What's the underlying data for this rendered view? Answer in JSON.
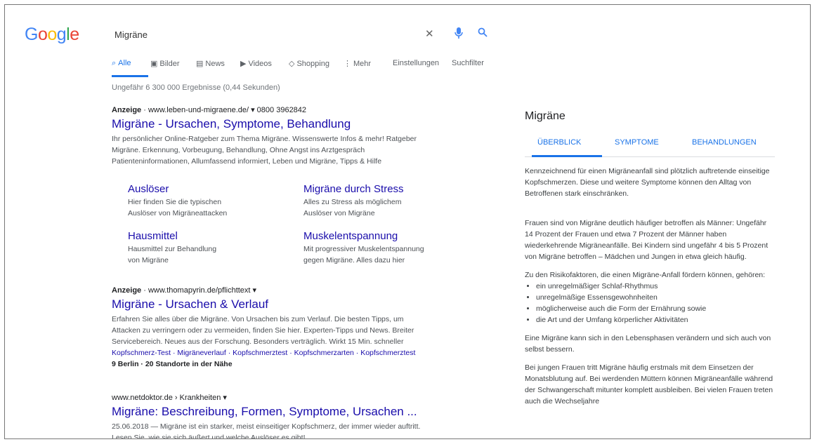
{
  "logo": [
    "G",
    "o",
    "o",
    "g",
    "l",
    "e"
  ],
  "logo_colors": [
    "#4285f4",
    "#ea4335",
    "#fbbc05",
    "#4285f4",
    "#34a853",
    "#ea4335"
  ],
  "search": {
    "query": "Migräne",
    "clear_icon": "close-icon",
    "mic_icon": "mic-icon",
    "search_icon": "search-icon"
  },
  "tabs": [
    {
      "icon": "⌕",
      "label": "Alle"
    },
    {
      "icon": "▣",
      "label": "Bilder"
    },
    {
      "icon": "▤",
      "label": "News"
    },
    {
      "icon": "▶",
      "label": "Videos"
    },
    {
      "icon": "◇",
      "label": "Shopping"
    },
    {
      "icon": "⋮",
      "label": "Mehr"
    },
    {
      "icon": "",
      "label": "Einstellungen"
    },
    {
      "icon": "",
      "label": "Suchfilter"
    }
  ],
  "stats": "Ungefähr 6 300 000 Ergebnisse (0,44 Sekunden)",
  "results": [
    {
      "ad_label": "Anzeige",
      "url": "· www.leben-und-migraene.de/ ▾  0800 3962842",
      "title": "Migräne - Ursachen, Symptome, Behandlung",
      "snippet": [
        "Ihr persönlicher Online-Ratgeber zum Thema Migräne. Wissenswerte Infos & mehr! Ratgeber",
        "Migräne. Erkennung, Vorbeugung, Behandlung, Ohne Angst ins Arztgespräch",
        "Patienteninformationen, Allumfassend informiert, Leben und Migräne, Tipps & Hilfe"
      ],
      "sitelinks": [
        {
          "title": "Auslöser",
          "desc": [
            "Hier finden Sie die typischen",
            "Auslöser von Migräneattacken"
          ]
        },
        {
          "title": "Migräne durch Stress",
          "desc": [
            "Alles zu Stress als möglichem",
            "Auslöser von Migräne"
          ]
        },
        {
          "title": "Hausmittel",
          "desc": [
            "Hausmittel zur Behandlung",
            "von Migräne"
          ]
        },
        {
          "title": "Muskelentspannung",
          "desc": [
            "Mit progressiver Muskelentspannung",
            "gegen Migräne. Alles dazu hier"
          ]
        }
      ]
    },
    {
      "ad_label": "Anzeige",
      "url": "· www.thomapyrin.de/pflichttext ▾",
      "title": "Migräne - Ursachen & Verlauf",
      "snippet": [
        "Erfahren Sie alles über die Migräne. Von Ursachen bis zum Verlauf. Die besten Tipps, um",
        "Attacken zu verringern oder zu vermeiden, finden Sie hier. Experten-Tipps und News. Breiter",
        "Servicebereich. Neues aus der Forschung. Besonders verträglich. Wirkt 15 Min. schneller",
        "Kopfschmerz-Test · Migräneverlauf · Kopfschmerztest · Kopfschmerzarten · Kopfschmerztest",
        "9 Berlin · 20 Standorte in der Nähe"
      ]
    },
    {
      "url": "www.netdoktor.de › Krankheiten ▾",
      "title": "Migräne: Beschreibung, Formen, Symptome, Ursachen ...",
      "snippet": [
        "25.06.2018 — Migräne ist ein starker, meist einseitiger Kopfschmerz, der immer wieder auftritt.",
        "Lesen Sie, wie sie sich äußert und welche Auslöser es gibt!"
      ]
    }
  ],
  "knowledge_panel": {
    "title": "Migräne",
    "tabs": [
      "ÜBERBLICK",
      "SYMPTOME",
      "BEHANDLUNGEN"
    ],
    "paragraphs": [
      "Kennzeichnend für einen Migräneanfall sind plötzlich auftretende einseitige Kopfschmerzen. Diese und weitere Symptome können den Alltag von Betroffenen stark einschränken.",
      "Frauen sind von Migräne deutlich häufiger betroffen als Männer: Ungefähr 14 Prozent der Frauen und etwa 7 Prozent der Männer haben wiederkehrende Migräneanfälle. Bei Kindern sind ungefähr 4 bis 5 Prozent von Migräne betroffen – Mädchen und Jungen in etwa gleich häufig.",
      "Zu den Risikofaktoren, die einen Migräne-Anfall fördern können, gehören:"
    ],
    "list": [
      "ein unregelmäßiger Schlaf-Rhythmus",
      "unregelmäßige Essensgewohnheiten",
      "möglicherweise auch die Form der Ernährung sowie",
      "die Art und der Umfang körperlicher Aktivitäten"
    ],
    "paragraphs_after": [
      "Eine Migräne kann sich in den Lebensphasen verändern und sich auch von selbst bessern.",
      "Bei jungen Frauen tritt Migräne häufig erstmals mit dem Einsetzen der Monatsblutung auf. Bei werdenden Müttern können Migräneanfälle während der Schwangerschaft mitunter komplett ausbleiben. Bei vielen Frauen treten auch die Wechseljahre"
    ]
  }
}
